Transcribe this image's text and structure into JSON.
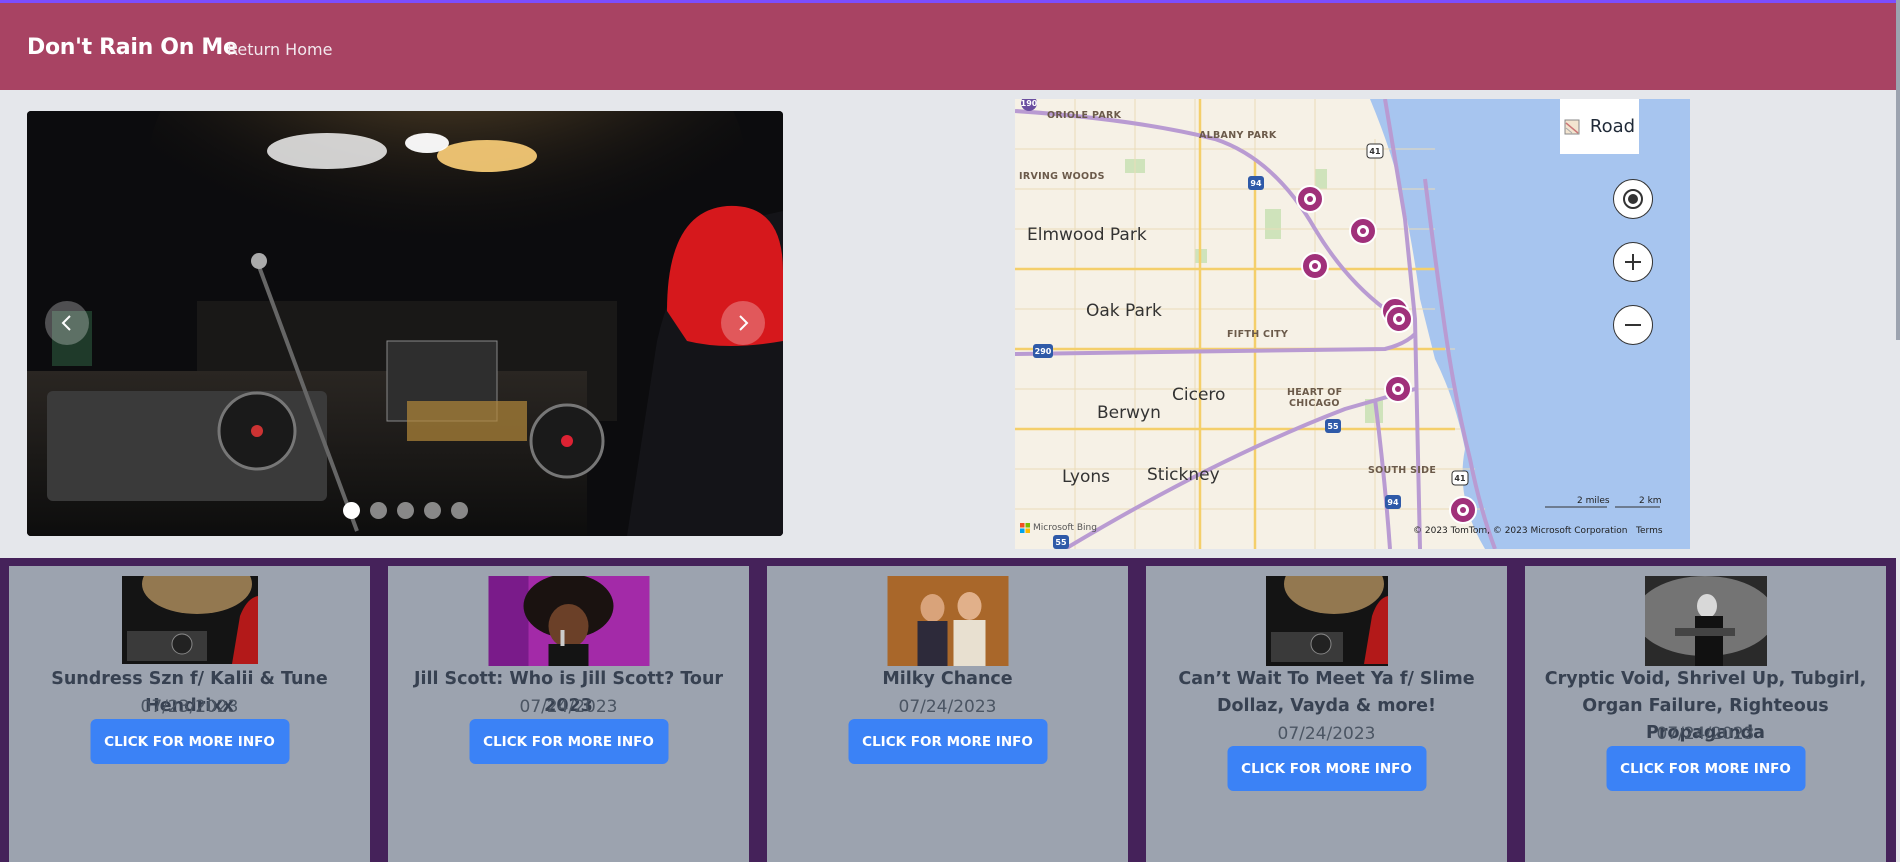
{
  "navbar": {
    "brand": "Don't Rain On Me",
    "return_home": "Return Home"
  },
  "carousel": {
    "slide_count": 5,
    "active_slide": 0
  },
  "map": {
    "style_label": "Road",
    "places": [
      "ORIOLE PARK",
      "ALBANY PARK",
      "IRVING WOODS",
      "Elmwood Park",
      "Oak Park",
      "FIFTH CITY",
      "Berwyn",
      "Cicero",
      "HEART OF",
      "CHICAGO",
      "SOUTH SIDE",
      "Lyons",
      "Stickney"
    ],
    "highways": [
      "190",
      "94",
      "41",
      "290",
      "55",
      "94",
      "41",
      "55"
    ],
    "scale_miles": "2 miles",
    "scale_km": "2 km",
    "attribution": "© 2023 TomTom, © 2023 Microsoft Corporation",
    "terms": "Terms",
    "logo": "Microsoft Bing",
    "pin_count": 8
  },
  "events": [
    {
      "title": "Sundress Szn f/ Kalii & Tune Hendrixx",
      "date": "07/23/2023",
      "button": "CLICK FOR MORE INFO",
      "thumb": "dj-stage"
    },
    {
      "title": "Jill Scott: Who is Jill Scott? Tour 2023",
      "date": "07/24/2023",
      "button": "CLICK FOR MORE INFO",
      "thumb": "singer"
    },
    {
      "title": "Milky Chance",
      "date": "07/24/2023",
      "button": "CLICK FOR MORE INFO",
      "thumb": "duo"
    },
    {
      "title": "Can’t Wait To Meet Ya f/ Slime Dollaz, Vayda & more!",
      "date": "07/24/2023",
      "button": "CLICK FOR MORE INFO",
      "thumb": "dj-stage"
    },
    {
      "title": "Cryptic Void, Shrivel Up, Tubgirl, Organ Failure, Righteous Propaganda",
      "date": "07/24/2023",
      "button": "CLICK FOR MORE INFO",
      "thumb": "guitarist"
    }
  ],
  "colors": {
    "navbar": "#a84363",
    "cards_bg": "#45225a",
    "card": "#9ca3af",
    "button": "#3b82f6",
    "pin": "#a0307a"
  }
}
